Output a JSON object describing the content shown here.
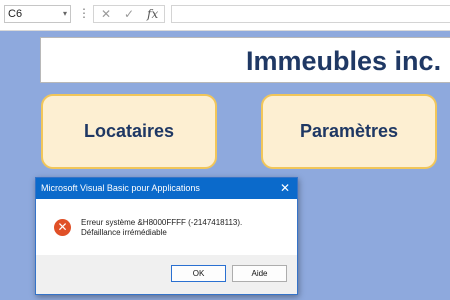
{
  "formula_bar": {
    "cell_ref": "C6",
    "dropdown_glyph": "▾",
    "dots": "⋮",
    "cancel_glyph": "✕",
    "enter_glyph": "✓",
    "fx_glyph": "fx",
    "formula": ""
  },
  "sheet": {
    "title": "Immeubles inc.",
    "buttons": {
      "tenants": "Locataires",
      "settings": "Paramètres"
    }
  },
  "dialog": {
    "title": "Microsoft Visual Basic pour Applications",
    "close_glyph": "✕",
    "icon_glyph": "✕",
    "message": "Erreur système &H8000FFFF (-2147418113).  Défaillance irrémédiable",
    "ok_label": "OK",
    "help_label": "Aide"
  },
  "colors": {
    "background": "#8ea9dd",
    "title_text": "#1f3864",
    "button_fill": "#fdefd2",
    "button_border": "#f1c65a",
    "dialog_titlebar": "#0b6acb",
    "error_icon": "#e05027"
  }
}
